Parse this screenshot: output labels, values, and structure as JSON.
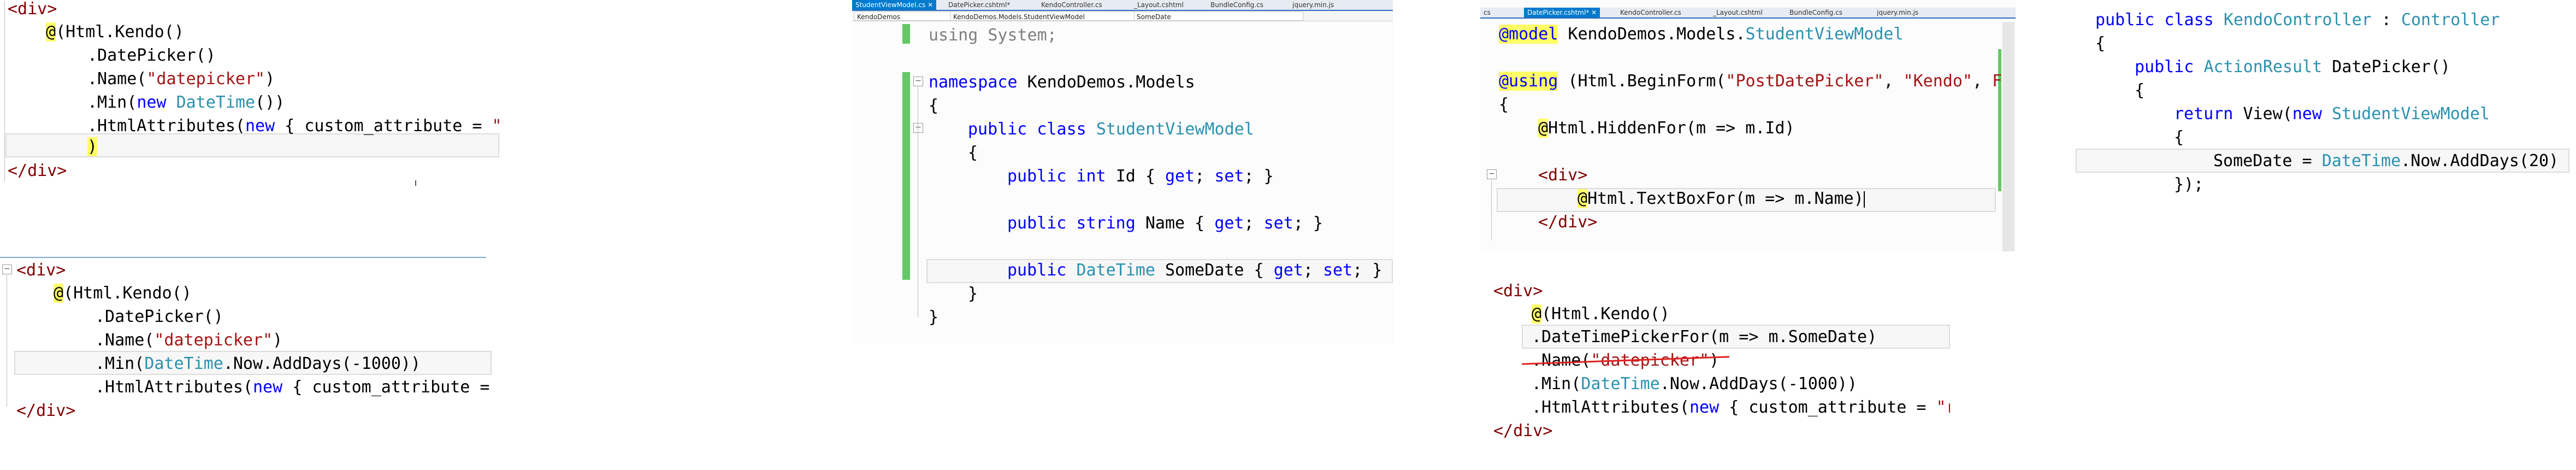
{
  "panel1": {
    "lines": [
      {
        "t": "<div>",
        "c": "tag"
      },
      {
        "a": "@",
        "b": "(Html.Kendo()"
      },
      {
        "t": ".DatePicker()"
      },
      {
        "p": ".Name(",
        "s": "\"datepicker\"",
        "q": ")"
      },
      {
        "p": ".Min(",
        "k": "new",
        "ty": "DateTime",
        "q": "())"
      },
      {
        "p": ".HtmlAttributes(",
        "k": "new",
        "q": "{ custom_attribute = ",
        "s": "\"r"
      },
      {
        "t": ")"
      },
      {
        "t": "</div>",
        "c": "tag"
      }
    ]
  },
  "panel2": {
    "lines": [
      {
        "t": "<div>"
      },
      {
        "a": "@",
        "b": "(Html.Kendo()"
      },
      {
        "t": ".DatePicker()"
      },
      {
        "p": ".Name(",
        "s": "\"datepicker\"",
        "q": ")"
      },
      {
        "p": ".Min(",
        "ty": "DateTime",
        "q": ".Now.AddDays(-1000))"
      },
      {
        "p": ".HtmlAttributes(",
        "k": "new",
        "q": "{ custom_attribute ="
      },
      {
        "t": "</div>"
      }
    ]
  },
  "panel3": {
    "tabs": [
      "StudentViewModel.cs",
      "DatePicker.cshtml*",
      "KendoController.cs",
      "_Layout.cshtml",
      "BundleConfig.cs",
      "jquery.min.js"
    ],
    "nav": [
      "KendoDemos",
      "KendoDemos.Models.StudentViewModel",
      "SomeDate"
    ],
    "using_kw": "using",
    "using_rest": "System;",
    "namespace_kw": "namespace",
    "namespace_name": "KendoDemos.Models",
    "open1": "{",
    "class_kw": "public class",
    "class_name": "StudentViewModel",
    "open2": "{",
    "prop1_kw": "public int",
    "prop1_name": "Id",
    "prop2_kw": "public string",
    "prop2_name": "Name",
    "prop3_kw": "public",
    "prop3_type": "DateTime",
    "prop3_name": "SomeDate",
    "get_kw": "get",
    "set_kw": "set",
    "close2": "}",
    "close1": "}"
  },
  "panel4": {
    "tabs": [
      "cs",
      "DatePicker.cshtml*",
      "KendoController.cs",
      "_Layout.cshtml",
      "BundleConfig.cs",
      "jquery.min.js"
    ],
    "model_kw": "@model",
    "model_ns": "KendoDemos.Models.",
    "model_type": "StudentViewModel",
    "using_kw": "@using",
    "using_rest": "(Html.BeginForm(",
    "using_s1": "\"PostDatePicker\"",
    "using_s2": "\"Kendo\"",
    "using_tail": "F",
    "open": "{",
    "hidden_at": "@",
    "hidden_rest": "Html.HiddenFor(m => m.Id)",
    "div_open": "<div>",
    "textbox_at": "@",
    "textbox_rest": "Html.TextBoxFor(m => m.Name)",
    "div_close": "</div>"
  },
  "panel5": {
    "lines": [
      {
        "t": "<div>"
      },
      {
        "a": "@",
        "b": "(Html.Kendo()"
      },
      {
        "t": ".DateTimePickerFor(m => m.SomeDate)"
      },
      {
        "p": ".Name(",
        "s": "\"datepicker\"",
        "q": ")"
      },
      {
        "p": ".Min(",
        "ty": "DateTime",
        "q": ".Now.AddDays(-1000))"
      },
      {
        "p": ".HtmlAttributes(",
        "k": "new",
        "q": "{ custom_attribute = ",
        "s": "\"r"
      },
      {
        "t": "</div>"
      }
    ]
  },
  "panel6": {
    "l1_kw": "public class",
    "l1_type": "KendoController",
    "l1_sep": " : ",
    "l1_base": "Controller",
    "l2": "{",
    "l3_kw": "public",
    "l3_type": "ActionResult",
    "l3_rest": "DatePicker()",
    "l4": "{",
    "l5_kw": "return",
    "l5_mid": "View(",
    "l5_kw2": "new",
    "l5_type": "StudentViewModel",
    "l6": "{",
    "l7_pre": "SomeDate = ",
    "l7_type": "DateTime",
    "l7_rest": ".Now.AddDays(20)",
    "l8": "});"
  }
}
